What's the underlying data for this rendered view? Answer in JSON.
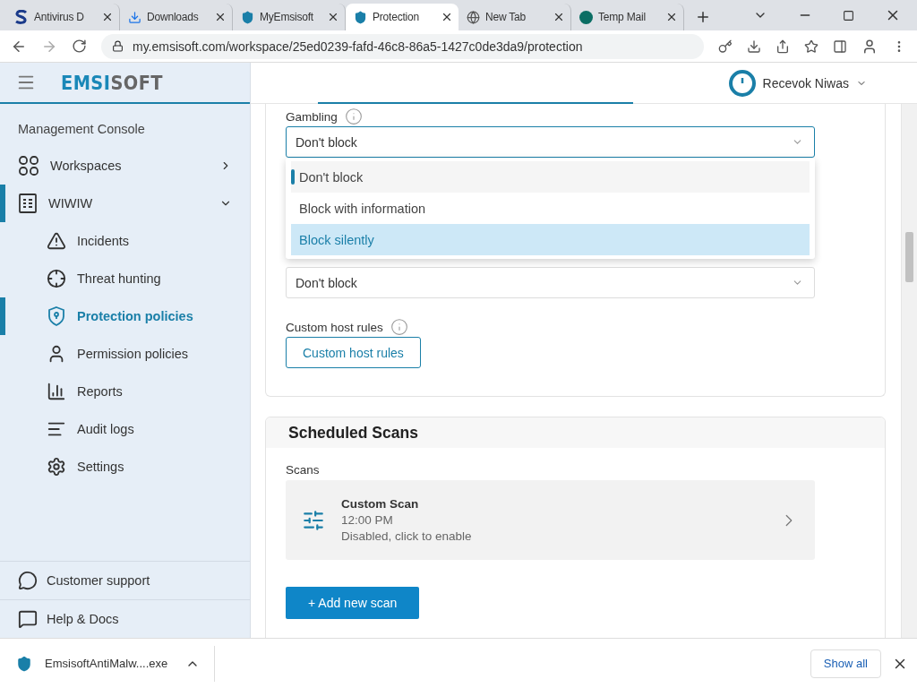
{
  "browser": {
    "tabs": [
      {
        "title": "Antivirus D",
        "selected": false
      },
      {
        "title": "Downloads",
        "selected": false
      },
      {
        "title": "MyEmsisoft",
        "selected": false
      },
      {
        "title": "Protection",
        "selected": true
      },
      {
        "title": "New Tab",
        "selected": false
      },
      {
        "title": "Temp Mail",
        "selected": false
      }
    ],
    "url": "my.emsisoft.com/workspace/25ed0239-fafd-46c8-86a5-1427c0de3da9/protection"
  },
  "sidebar": {
    "logo": {
      "part_1": "EMSI",
      "part_2": "SOFT"
    },
    "section_title": "Management Console",
    "items": [
      {
        "label": "Workspaces",
        "selected": false,
        "expanded": false
      },
      {
        "label": "WIWIW",
        "selected": true,
        "expanded": true,
        "children": [
          {
            "label": "Incidents",
            "selected": false
          },
          {
            "label": "Threat hunting",
            "selected": false
          },
          {
            "label": "Protection policies",
            "selected": true
          },
          {
            "label": "Permission policies",
            "selected": false
          },
          {
            "label": "Reports",
            "selected": false
          },
          {
            "label": "Audit logs",
            "selected": false
          },
          {
            "label": "Settings",
            "selected": false
          }
        ]
      }
    ],
    "footer_items": [
      "Customer support",
      "Help & Docs"
    ]
  },
  "header": {
    "user": "Recevok Niwas"
  },
  "web_filter": {
    "gambling": {
      "label": "Gambling",
      "value": "Don't block",
      "options": [
        {
          "label": "Don't block",
          "selected": true,
          "highlighted": false
        },
        {
          "label": "Block with information",
          "selected": false,
          "highlighted": false
        },
        {
          "label": "Block silently",
          "selected": false,
          "highlighted": true
        }
      ]
    },
    "second_select": {
      "value": "Don't block"
    },
    "custom_host_rules": {
      "label": "Custom host rules",
      "button": "Custom host rules"
    }
  },
  "scheduled_scans": {
    "title": "Scheduled Scans",
    "scans_label": "Scans",
    "scans": [
      {
        "name": "Custom Scan",
        "time": "12:00 PM",
        "status": "Disabled, click to enable"
      }
    ],
    "add_button": "+ Add new scan"
  },
  "downloads": {
    "file": "EmsisoftAntiMalw....exe",
    "show_all": "Show all"
  }
}
